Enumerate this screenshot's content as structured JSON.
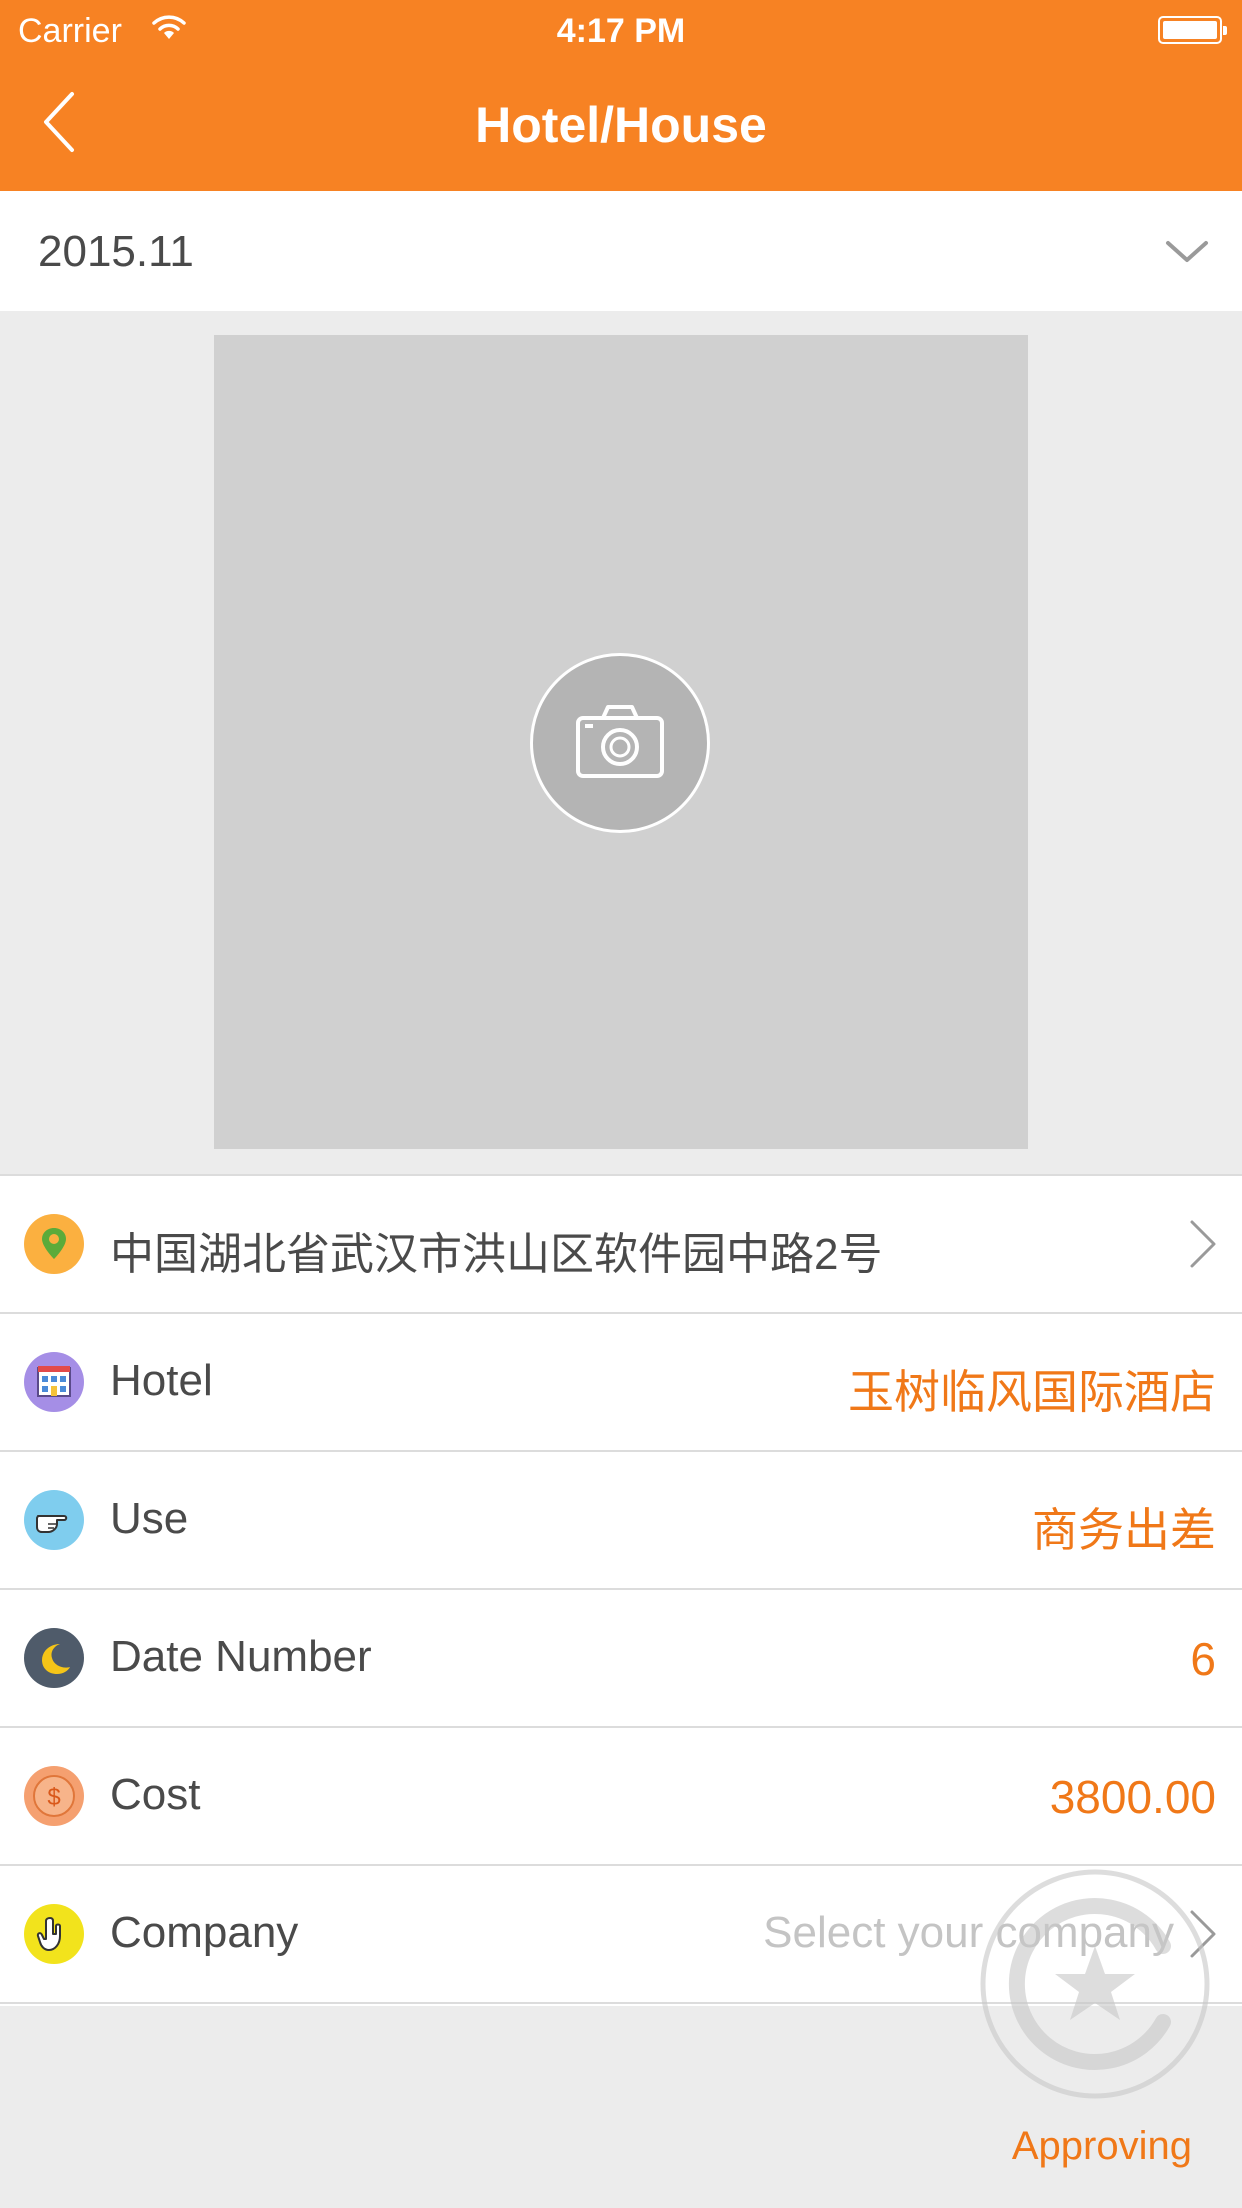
{
  "status_bar": {
    "carrier": "Carrier",
    "time": "4:17 PM"
  },
  "nav": {
    "title": "Hotel/House",
    "back_icon": "chevron-left-icon"
  },
  "month_picker": {
    "value": "2015.11",
    "icon": "chevron-down-icon"
  },
  "photo": {
    "icon": "camera-icon"
  },
  "rows": [
    {
      "icon": "location-pin-icon",
      "label": "中国湖北省武汉市洪山区软件园中路2号",
      "value": "",
      "chevron": true
    },
    {
      "icon": "hotel-building-icon",
      "label": "Hotel",
      "value": "玉树临风国际酒店"
    },
    {
      "icon": "pointing-hand-icon",
      "label": "Use",
      "value": "商务出差"
    },
    {
      "icon": "moon-icon",
      "label": "Date Number",
      "value": "6"
    },
    {
      "icon": "dollar-icon",
      "label": "Cost",
      "value": "3800.00"
    },
    {
      "icon": "raised-hand-icon",
      "label": "Company",
      "placeholder": "Select your company",
      "chevron": true
    }
  ],
  "status": {
    "label": "Approving",
    "icon": "star-stamp-icon"
  },
  "colors": {
    "accent": "#f78223",
    "value_text": "#f07818",
    "label_text": "#4a4a4a",
    "placeholder": "#c4c4c4"
  }
}
